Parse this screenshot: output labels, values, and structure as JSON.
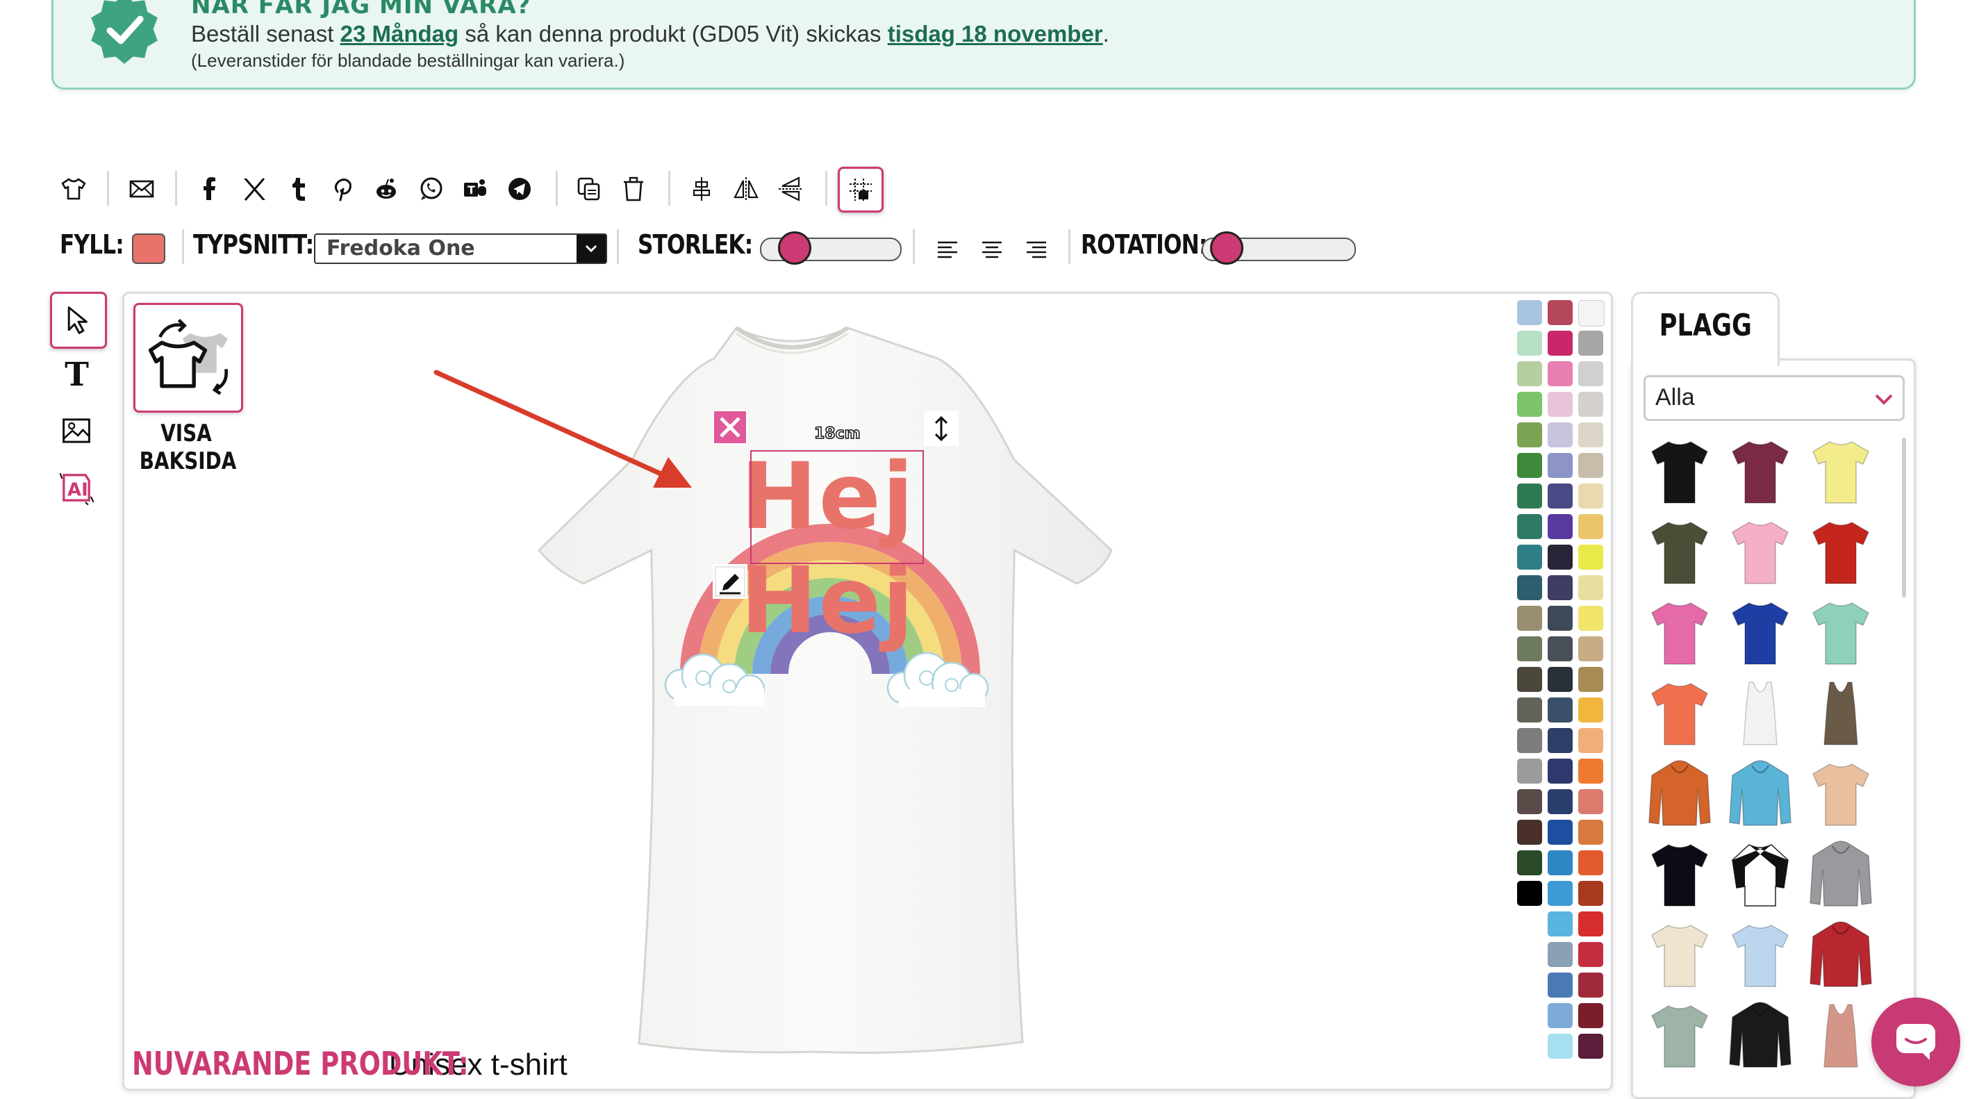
{
  "banner": {
    "title": "NÄR FÅR JAG MIN VARA?",
    "line1_pre": "Beställ senast ",
    "line1_deadline": "23 Måndag",
    "line1_mid": " så kan denna produkt (GD05 Vit) skickas ",
    "line1_date": "tisdag 18 november",
    "line1_post": ".",
    "line2": "(Leveranstider för blandade beställningar kan variera.)",
    "accent": "#2a8a66"
  },
  "toolbar": {
    "icons": [
      "tshirt-icon",
      "mail-icon",
      "facebook-icon",
      "x-icon",
      "tumblr-icon",
      "pinterest-icon",
      "reddit-icon",
      "whatsapp-icon",
      "teams-icon",
      "telegram-icon",
      "duplicate-icon",
      "trash-icon",
      "align-center-icon",
      "flip-horizontal-icon",
      "flip-vertical-icon",
      "grid-icon"
    ]
  },
  "format": {
    "fill_label": "FYLL:",
    "fill_color": "#e8736a",
    "font_label": "TYPSNITT:",
    "font_value": "Fredoka One",
    "size_label": "STORLEK:",
    "size_level": 0.18,
    "rotation_label": "ROTATION:",
    "rotation_level": 0.08,
    "align_icons": [
      "align-left-icon",
      "align-center-text-icon",
      "align-right-icon"
    ]
  },
  "tools": [
    "cursor-icon",
    "text-icon",
    "image-icon",
    "ai-icon"
  ],
  "design": {
    "show_back_label_1": "VISA",
    "show_back_label_2": "BAKSIDA",
    "text_line1": "Hej",
    "text_line2": "Hej",
    "width_tag": "18cm",
    "current_product_label": "NUVARANDE PRODUKT:",
    "current_product_value": "Unisex t-shirt",
    "brand_pink": "#cc3a74"
  },
  "palette": {
    "col1": [
      "#a9c4de",
      "#b6e0c4",
      "#b5cf9e",
      "#7cc46a",
      "#7aa451",
      "#3e8a3a",
      "#2e7a50",
      "#2e7a66",
      "#2f7f86",
      "#2c5e6e",
      "#9a8e72",
      "#6e7a5e",
      "#4a463a",
      "#626258",
      "#7c7c7c",
      "#9c9c9c",
      "#5a4a48",
      "#4a3028",
      "#2a4a2a",
      "#000000"
    ],
    "col2": [
      "#b4475a",
      "#c8276a",
      "#e77fb0",
      "#e8c4d8",
      "#c8c4e0",
      "#8c94c8",
      "#4a4a86",
      "#5a3aa0",
      "#2a2438",
      "#3e3e62",
      "#3e4a58",
      "#4a5058",
      "#2a3038",
      "#3a5068",
      "#2e3e66",
      "#2e3a6e",
      "#2a3e6e",
      "#1e4ea0",
      "#2f86c4",
      "#3e9ad4",
      "#5ab4e0",
      "#8aa0b4",
      "#4a7ab4",
      "#7eaad8",
      "#a6e0f0"
    ],
    "col3": [
      "#f4f4f4",
      "#a6a6a6",
      "#d0d0d0",
      "#d4d0cc",
      "#dcd6c8",
      "#c8bcaa",
      "#ead8b0",
      "#ecc46a",
      "#e8ea4a",
      "#e8df9e",
      "#f0e46a",
      "#c8ac86",
      "#a88a54",
      "#f2b63e",
      "#f2ae7a",
      "#ee7a2e",
      "#dc7a6e",
      "#d67a3e",
      "#e25a2e",
      "#a83a1e",
      "#d62e2e",
      "#c42e3e",
      "#a02a3a",
      "#7a1e2a",
      "#5a1e3a"
    ]
  },
  "panel": {
    "tab_label": "PLAGG",
    "filter_value": "Alla"
  },
  "garments": [
    {
      "name": "tshirt-black",
      "color": "#151515",
      "shape": "tee"
    },
    {
      "name": "tshirt-maroon",
      "color": "#7a2a44",
      "shape": "tee"
    },
    {
      "name": "tshirt-yellow",
      "color": "#f2ec8a",
      "shape": "tee"
    },
    {
      "name": "tshirt-olive",
      "color": "#4a4e36",
      "shape": "tee"
    },
    {
      "name": "tshirt-pink-women",
      "color": "#f4aec8",
      "shape": "tee"
    },
    {
      "name": "tshirt-red",
      "color": "#c4261e",
      "shape": "tee"
    },
    {
      "name": "tshirt-magenta",
      "color": "#e46aa8",
      "shape": "tee"
    },
    {
      "name": "tshirt-royal",
      "color": "#1e3ea4",
      "shape": "tee"
    },
    {
      "name": "tshirt-mint",
      "color": "#8ed0b8",
      "shape": "tee"
    },
    {
      "name": "tshirt-coral",
      "color": "#f0704e",
      "shape": "tee"
    },
    {
      "name": "tank-white",
      "color": "#f2f2f2",
      "shape": "tank"
    },
    {
      "name": "tank-brown",
      "color": "#6a5a48",
      "shape": "tank"
    },
    {
      "name": "hoodie-orange",
      "color": "#d4642a",
      "shape": "hoodie"
    },
    {
      "name": "hoodie-skyblue",
      "color": "#5ab4d8",
      "shape": "hoodie"
    },
    {
      "name": "tshirt-tiedye",
      "color": "#e8c0a0",
      "shape": "tee"
    },
    {
      "name": "tshirt-black-v",
      "color": "#0c0c14",
      "shape": "tee"
    },
    {
      "name": "raglan-white-black",
      "color": "#ffffff",
      "shape": "raglan"
    },
    {
      "name": "hoodie-gray",
      "color": "#9a9a9e",
      "shape": "hoodie"
    },
    {
      "name": "tshirt-cream",
      "color": "#efe4d0",
      "shape": "tee"
    },
    {
      "name": "tshirt-gradient-blue",
      "color": "#bcd6ee",
      "shape": "tee"
    },
    {
      "name": "jacket-red",
      "color": "#b8262e",
      "shape": "hoodie"
    },
    {
      "name": "longsleeve-sage",
      "color": "#9eb4a6",
      "shape": "tee"
    },
    {
      "name": "hoodie-black-orange",
      "color": "#1a1a1a",
      "shape": "hoodie"
    },
    {
      "name": "tank-rose",
      "color": "#d49688",
      "shape": "tank"
    }
  ]
}
